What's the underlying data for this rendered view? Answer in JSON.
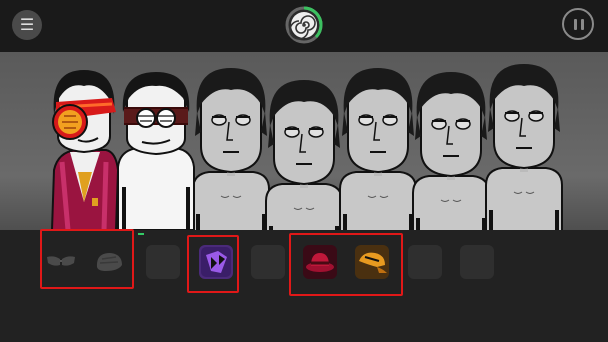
{
  "topbar": {
    "menu_icon": "☰",
    "logo": "spiral-logo",
    "pause": "pause-icon"
  },
  "stage": {
    "characters": [
      {
        "slot": 1,
        "state": "active",
        "costume": "red-jacket-visor"
      },
      {
        "slot": 2,
        "state": "active",
        "costume": "blindfold"
      },
      {
        "slot": 3,
        "state": "idle"
      },
      {
        "slot": 4,
        "state": "idle"
      },
      {
        "slot": 5,
        "state": "idle"
      },
      {
        "slot": 6,
        "state": "idle"
      },
      {
        "slot": 7,
        "state": "idle"
      }
    ]
  },
  "tray": {
    "icons": [
      {
        "name": "sunglasses-icon",
        "state": "used"
      },
      {
        "name": "cap-icon",
        "state": "used"
      },
      {
        "name": "empty-slot",
        "state": "empty"
      },
      {
        "name": "purple-shape-icon",
        "state": "available",
        "color": "#8a4ce0"
      },
      {
        "name": "empty-slot",
        "state": "empty"
      },
      {
        "name": "red-fedora-icon",
        "state": "available",
        "color": "#c0183a"
      },
      {
        "name": "orange-cap-icon",
        "state": "available",
        "color": "#e89a20"
      },
      {
        "name": "empty-slot",
        "state": "empty"
      },
      {
        "name": "empty-slot",
        "state": "empty"
      }
    ]
  },
  "colors": {
    "highlight": "#e01818",
    "progress": "#3cc060"
  }
}
